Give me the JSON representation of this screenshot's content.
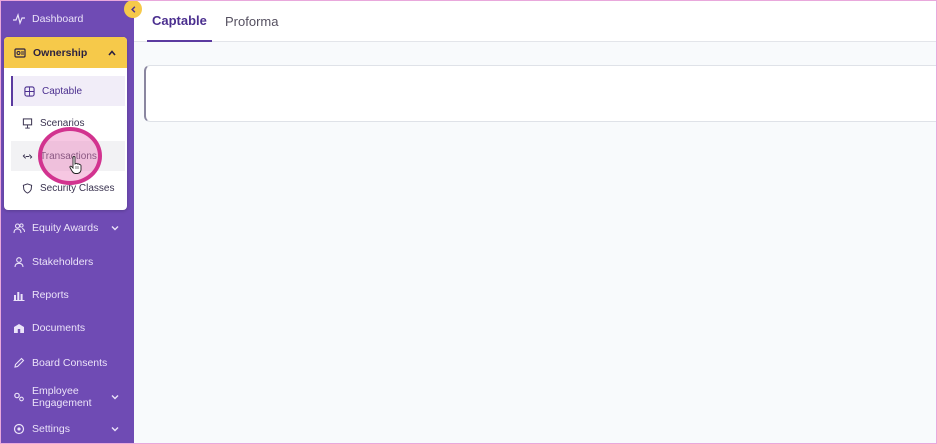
{
  "sidebar": {
    "collapse_icon": "chevron-left-icon",
    "items": [
      {
        "id": "dashboard",
        "label": "Dashboard",
        "icon": "activity-icon"
      },
      {
        "id": "equity-awards",
        "label": "Equity Awards",
        "icon": "users-icon"
      },
      {
        "id": "stakeholders",
        "label": "Stakeholders",
        "icon": "person-icon"
      },
      {
        "id": "reports",
        "label": "Reports",
        "icon": "bar-chart-icon"
      },
      {
        "id": "documents",
        "label": "Documents",
        "icon": "building-icon"
      },
      {
        "id": "board-consents",
        "label": "Board Consents",
        "icon": "pen-icon"
      },
      {
        "id": "employee-engagement",
        "label_line1": "Employee",
        "label_line2": "Engagement",
        "icon": "gears-icon"
      },
      {
        "id": "settings",
        "label": "Settings",
        "icon": "settings-icon"
      }
    ],
    "ownership": {
      "label": "Ownership",
      "icon": "ownership-icon",
      "sub_items": [
        {
          "id": "captable",
          "label": "Captable",
          "icon": "grid-icon"
        },
        {
          "id": "scenarios",
          "label": "Scenarios",
          "icon": "presentation-icon"
        },
        {
          "id": "transactions",
          "label": "Transactions",
          "icon": "link-icon"
        },
        {
          "id": "security-classes",
          "label": "Security Classes",
          "icon": "shield-icon"
        }
      ]
    }
  },
  "main": {
    "tabs": [
      {
        "label": "Captable",
        "active": true
      },
      {
        "label": "Proforma",
        "active": false
      }
    ]
  },
  "colors": {
    "sidebar_bg": "#6f4bb4",
    "accent_yellow": "#f6c94a",
    "accent_purple": "#5b3aa0",
    "click_indicator": "#d2338f"
  }
}
